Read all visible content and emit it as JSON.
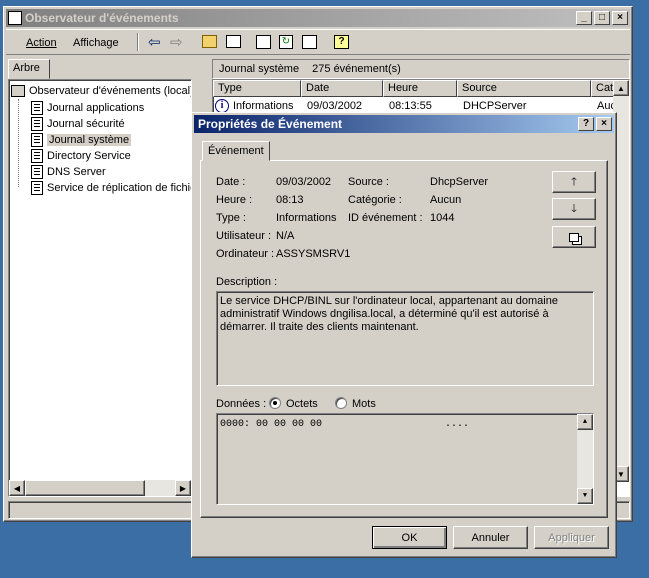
{
  "main_window": {
    "title": "Observateur d'événements",
    "menu": {
      "action": "Action",
      "view": "Affichage"
    },
    "tab_tree": "Arbre",
    "tree_root": "Observateur d'événements (local)",
    "tree_items": [
      "Journal applications",
      "Journal sécurité",
      "Journal système",
      "Directory Service",
      "DNS Server",
      "Service de réplication de fichie"
    ],
    "log_name": "Journal système",
    "event_count": "275 événement(s)",
    "columns": [
      "Type",
      "Date",
      "Heure",
      "Source",
      "Cat"
    ],
    "row": {
      "type": "Informations",
      "date": "09/03/2002",
      "time": "08:13:55",
      "source": "DHCPServer",
      "cat": "Auc"
    }
  },
  "dialog": {
    "title": "Propriétés de Événement",
    "tab": "Événement",
    "date_label": "Date :",
    "date_value": "09/03/2002",
    "source_label": "Source :",
    "source_value": "DhcpServer",
    "time_label": "Heure :",
    "time_value": "08:13",
    "category_label": "Catégorie :",
    "category_value": "Aucun",
    "type_label": "Type :",
    "type_value": "Informations",
    "event_id_label": "ID événement :",
    "event_id_value": "1044",
    "user_label": "Utilisateur :",
    "user_value": "N/A",
    "computer_label": "Ordinateur :",
    "computer_value": "ASSYSMSRV1",
    "description_label": "Description :",
    "description": "Le service DHCP/BINL sur l'ordinateur local, appartenant au domaine administratif Windows dngilisa.local, a déterminé qu'il est autorisé à démarrer. Il traite des clients maintenant.",
    "data_label": "Données :",
    "radio_bytes": "Octets",
    "radio_words": "Mots",
    "data_content": "0000: 00 00 00 00",
    "data_ascii": "....",
    "ok": "OK",
    "cancel": "Annuler",
    "apply": "Appliquer"
  }
}
